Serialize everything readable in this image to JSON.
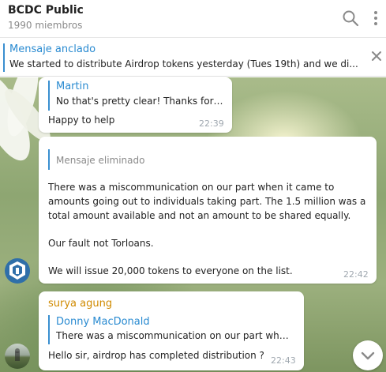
{
  "header": {
    "title": "BCDC Public",
    "members": "1990 miembros",
    "icons": [
      "search-icon",
      "more-vertical-icon"
    ]
  },
  "pinned": {
    "title": "Mensaje anclado",
    "text": "We started to distribute Airdrop tokens yesterday (Tues 19th) and we di...",
    "close_icon": "close-icon"
  },
  "messages": [
    {
      "reply": {
        "name": "Martin",
        "text": "No that's pretty clear! Thanks for ..."
      },
      "text": "Happy to help",
      "time": "22:39"
    },
    {
      "reply": {
        "deleted": "Mensaje eliminado"
      },
      "paragraphs": [
        "There was a miscommunication on our part when it came to amounts going out to individuals taking part. The 1.5 million was a total amount available and not an amount to be shared equally.",
        "Our fault not Torloans.",
        "We will issue 20,000 tokens to everyone on the list."
      ],
      "time": "22:42",
      "avatar_icon": "shield-logo-icon"
    },
    {
      "sender": "surya agung",
      "reply": {
        "name": "Donny MacDonald",
        "text": "There was a miscommunication on our part whe..."
      },
      "text": "Hello sir, airdrop has completed distribution ?",
      "time": "22:43",
      "avatar_icon": "user-photo-avatar"
    }
  ],
  "colors": {
    "accent": "#2a8bd1",
    "sender_name": "#d08a00",
    "time": "#a0a8b0"
  }
}
